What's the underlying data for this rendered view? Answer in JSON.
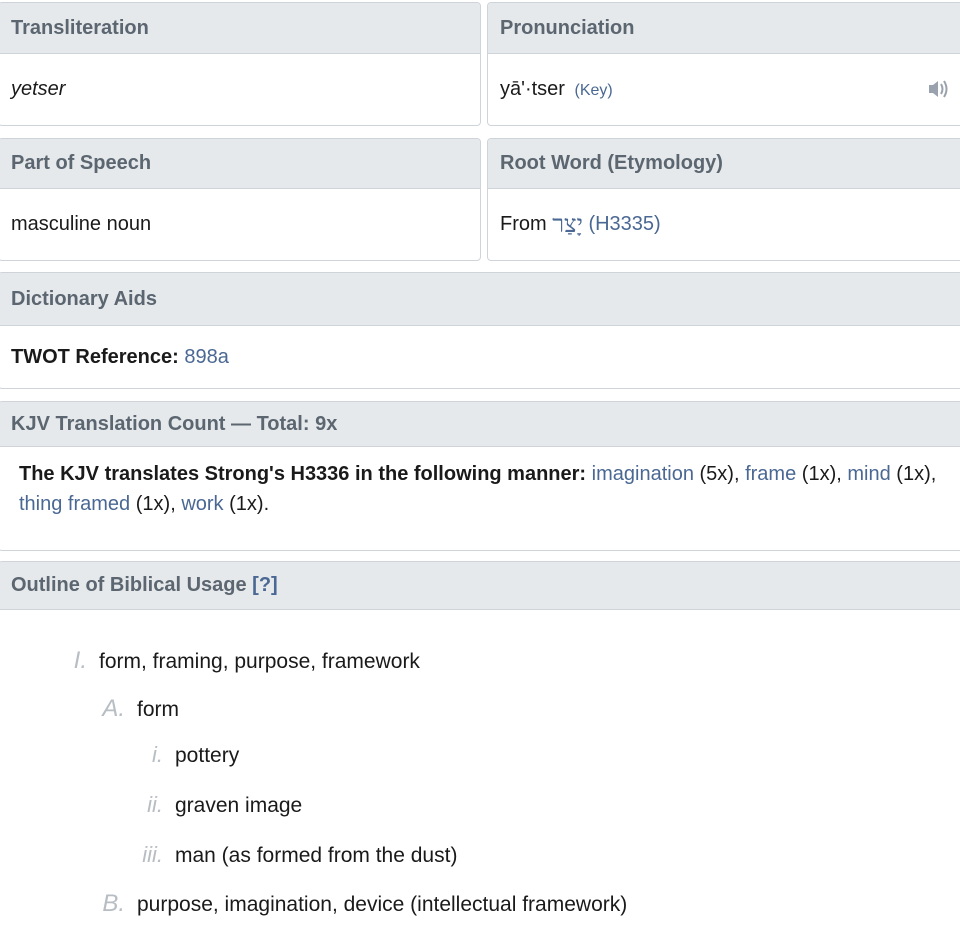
{
  "transliteration": {
    "header": "Transliteration",
    "value": "yetser"
  },
  "pronunciation": {
    "header": "Pronunciation",
    "value": "yā'·tser",
    "key_label": "(Key)",
    "audio_icon": "speaker-icon"
  },
  "part_of_speech": {
    "header": "Part of Speech",
    "value": "masculine noun"
  },
  "root_word": {
    "header": "Root Word (Etymology)",
    "prefix": "From",
    "hebrew": "יָצַר",
    "strongs": "(H3335)"
  },
  "dictionary_aids": {
    "header": "Dictionary Aids",
    "twot_label": "TWOT Reference:",
    "twot_value": "898a"
  },
  "kjv": {
    "header": "KJV Translation Count — Total: 9x",
    "intro": "The KJV translates Strong's H3336 in the following manner:",
    "items": [
      {
        "word": "imagination",
        "count": "(5x)",
        "sep": ","
      },
      {
        "word": "frame",
        "count": "(1x)",
        "sep": ","
      },
      {
        "word": "mind",
        "count": "(1x)",
        "sep": ","
      },
      {
        "word": "thing framed",
        "count": "(1x)",
        "sep": ","
      },
      {
        "word": "work",
        "count": "(1x)",
        "sep": "."
      }
    ]
  },
  "outline": {
    "header": "Outline of Biblical Usage",
    "help_label": "[?]",
    "items": [
      {
        "num": "I.",
        "text": "form, framing, purpose, framework"
      },
      {
        "num": "A.",
        "text": "form"
      },
      {
        "num": "i.",
        "text": "pottery"
      },
      {
        "num": "ii.",
        "text": "graven image"
      },
      {
        "num": "iii.",
        "text": "man (as formed from the dust)"
      },
      {
        "num": "B.",
        "text": "purpose, imagination, device (intellectual framework)"
      }
    ]
  },
  "colors": {
    "link": "#4a6893",
    "header_bg": "#e6e9ec",
    "header_text": "#5b6670",
    "border": "#cfd4da",
    "outline_numeral": "#b7bdc3"
  }
}
